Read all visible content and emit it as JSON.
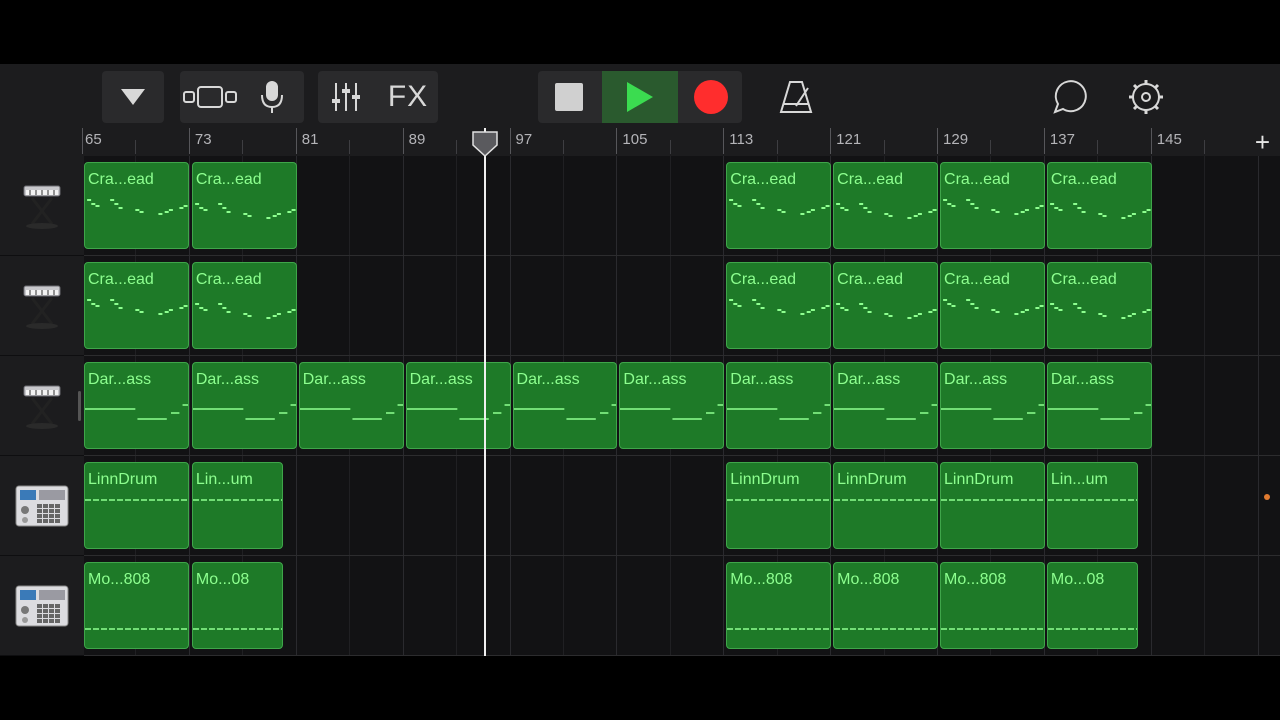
{
  "toolbar": {
    "fx_label": "FX",
    "buttons": [
      {
        "name": "browser-toggle-icon"
      },
      {
        "name": "tracks-view-icon"
      },
      {
        "name": "microphone-icon"
      },
      {
        "name": "mixer-icon"
      },
      {
        "name": "stop-icon"
      },
      {
        "name": "play-icon"
      },
      {
        "name": "record-icon"
      },
      {
        "name": "metronome-icon"
      },
      {
        "name": "loop-icon"
      },
      {
        "name": "settings-gear-icon"
      }
    ],
    "colors": {
      "play_bg": "#2a5a2e",
      "play_icon": "#3bdc50",
      "record": "#ff2d2d",
      "stop": "#d0d0d0"
    }
  },
  "ruler": {
    "bars": [
      "65",
      "73",
      "81",
      "89",
      "97",
      "105",
      "113",
      "121",
      "129",
      "137",
      "145"
    ],
    "add_label": "+"
  },
  "tracks": [
    {
      "instrument_icon": "keyboard-synth-icon",
      "regions": [
        {
          "label": "Cra...ead",
          "start": 0,
          "len": 8
        },
        {
          "label": "Cra...ead",
          "start": 8,
          "len": 8
        },
        {
          "label": "Cra...ead",
          "start": 48,
          "len": 8
        },
        {
          "label": "Cra...ead",
          "start": 56,
          "len": 8
        },
        {
          "label": "Cra...ead",
          "start": 64,
          "len": 8
        },
        {
          "label": "Cra...ead",
          "start": 72,
          "len": 8
        }
      ]
    },
    {
      "instrument_icon": "keyboard-synth-icon",
      "regions": [
        {
          "label": "Cra...ead",
          "start": 0,
          "len": 8
        },
        {
          "label": "Cra...ead",
          "start": 8,
          "len": 8
        },
        {
          "label": "Cra...ead",
          "start": 48,
          "len": 8
        },
        {
          "label": "Cra...ead",
          "start": 56,
          "len": 8
        },
        {
          "label": "Cra...ead",
          "start": 64,
          "len": 8
        },
        {
          "label": "Cra...ead",
          "start": 72,
          "len": 8
        }
      ]
    },
    {
      "instrument_icon": "keyboard-synth-icon",
      "selected": true,
      "regions": [
        {
          "label": "Dar...ass",
          "start": 0,
          "len": 8
        },
        {
          "label": "Dar...ass",
          "start": 8,
          "len": 8
        },
        {
          "label": "Dar...ass",
          "start": 16,
          "len": 8
        },
        {
          "label": "Dar...ass",
          "start": 24,
          "len": 8
        },
        {
          "label": "Dar...ass",
          "start": 32,
          "len": 8
        },
        {
          "label": "Dar...ass",
          "start": 40,
          "len": 8
        },
        {
          "label": "Dar...ass",
          "start": 48,
          "len": 8
        },
        {
          "label": "Dar...ass",
          "start": 56,
          "len": 8
        },
        {
          "label": "Dar...ass",
          "start": 64,
          "len": 8
        },
        {
          "label": "Dar...ass",
          "start": 72,
          "len": 8
        }
      ]
    },
    {
      "instrument_icon": "drum-machine-icon",
      "regions": [
        {
          "label": "LinnDrum",
          "start": 0,
          "len": 8
        },
        {
          "label": "Lin...um",
          "start": 8,
          "len": 7
        },
        {
          "label": "LinnDrum",
          "start": 48,
          "len": 8
        },
        {
          "label": "LinnDrum",
          "start": 56,
          "len": 8
        },
        {
          "label": "LinnDrum",
          "start": 64,
          "len": 8
        },
        {
          "label": "Lin...um",
          "start": 72,
          "len": 7
        }
      ]
    },
    {
      "instrument_icon": "drum-machine-icon",
      "regions": [
        {
          "label": "Mo...808",
          "start": 0,
          "len": 8
        },
        {
          "label": "Mo...08",
          "start": 8,
          "len": 7
        },
        {
          "label": "Mo...808",
          "start": 48,
          "len": 8
        },
        {
          "label": "Mo...808",
          "start": 56,
          "len": 8
        },
        {
          "label": "Mo...808",
          "start": 64,
          "len": 8
        },
        {
          "label": "Mo...08",
          "start": 72,
          "len": 7
        }
      ]
    }
  ],
  "playhead": {
    "bar": 102.5
  }
}
